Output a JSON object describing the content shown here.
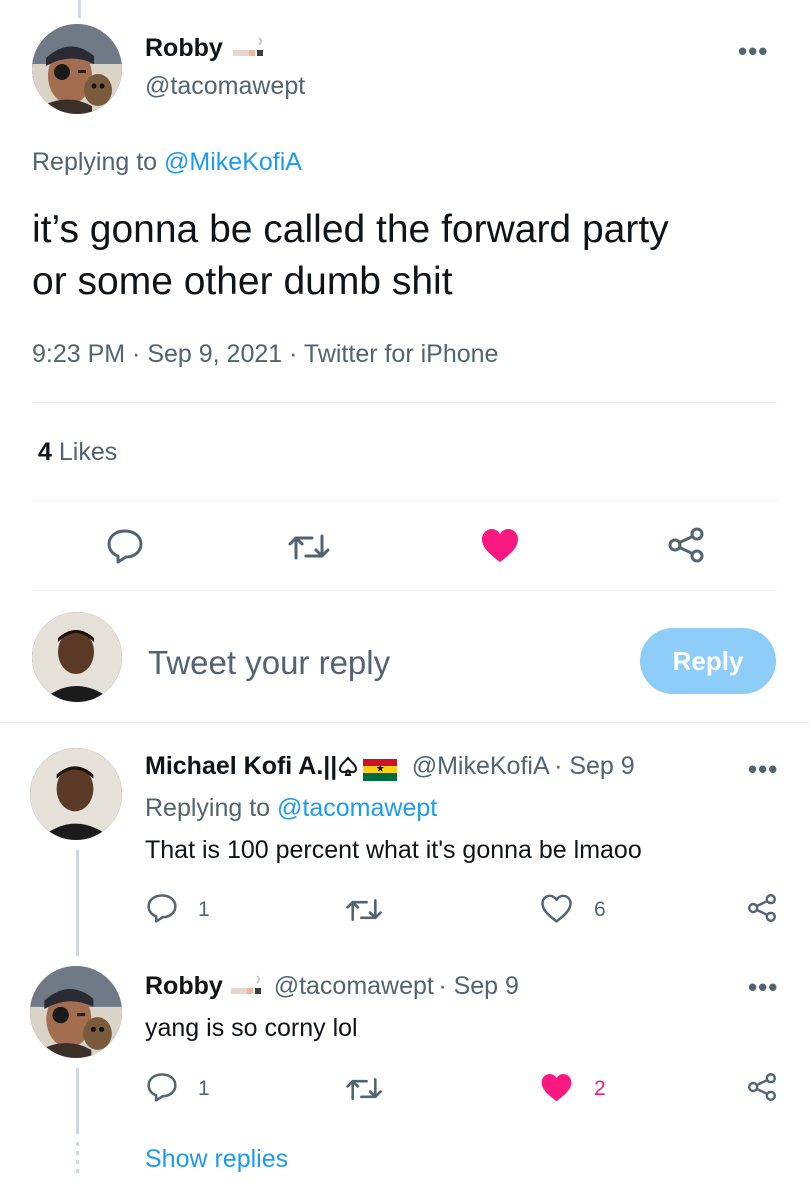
{
  "main_tweet": {
    "author_name": "Robby",
    "author_handle": "@tacomawept",
    "more": "•••",
    "replying_label": "Replying to ",
    "replying_to": "@MikeKofiA",
    "text_line1": "it’s gonna be called the forward party",
    "text_line2": "or some other dumb shit",
    "meta": "9:23 PM · Sep 9, 2021 · Twitter for iPhone",
    "likes_count": "4",
    "likes_label": "Likes",
    "liked": true
  },
  "compose": {
    "placeholder": "Tweet your reply",
    "reply_button": "Reply"
  },
  "replies": [
    {
      "author_name": "Michael Kofi A.||",
      "author_handle": "@MikeKofiA",
      "date": "· Sep 9",
      "more": "•••",
      "replying_label": "Replying to ",
      "replying_to": "@tacomawept",
      "text": "That is 100 percent what it's gonna be lmaoo",
      "reply_count": "1",
      "like_count": "6",
      "liked": false
    },
    {
      "author_name": "Robby",
      "author_handle": "@tacomawept",
      "date": "· Sep 9",
      "more": "•••",
      "text": "yang is so corny lol",
      "reply_count": "1",
      "like_count": "2",
      "liked": true
    }
  ],
  "show_replies": "Show replies",
  "colors": {
    "accent": "#1d9bf0",
    "like_pink": "#f91880",
    "reply_button_disabled": "#8ecdf8",
    "secondary_text": "#536471"
  },
  "icons": {
    "reply": "reply-icon",
    "retweet": "retweet-icon",
    "like": "heart-icon",
    "share": "share-icon",
    "more": "more-icon"
  }
}
